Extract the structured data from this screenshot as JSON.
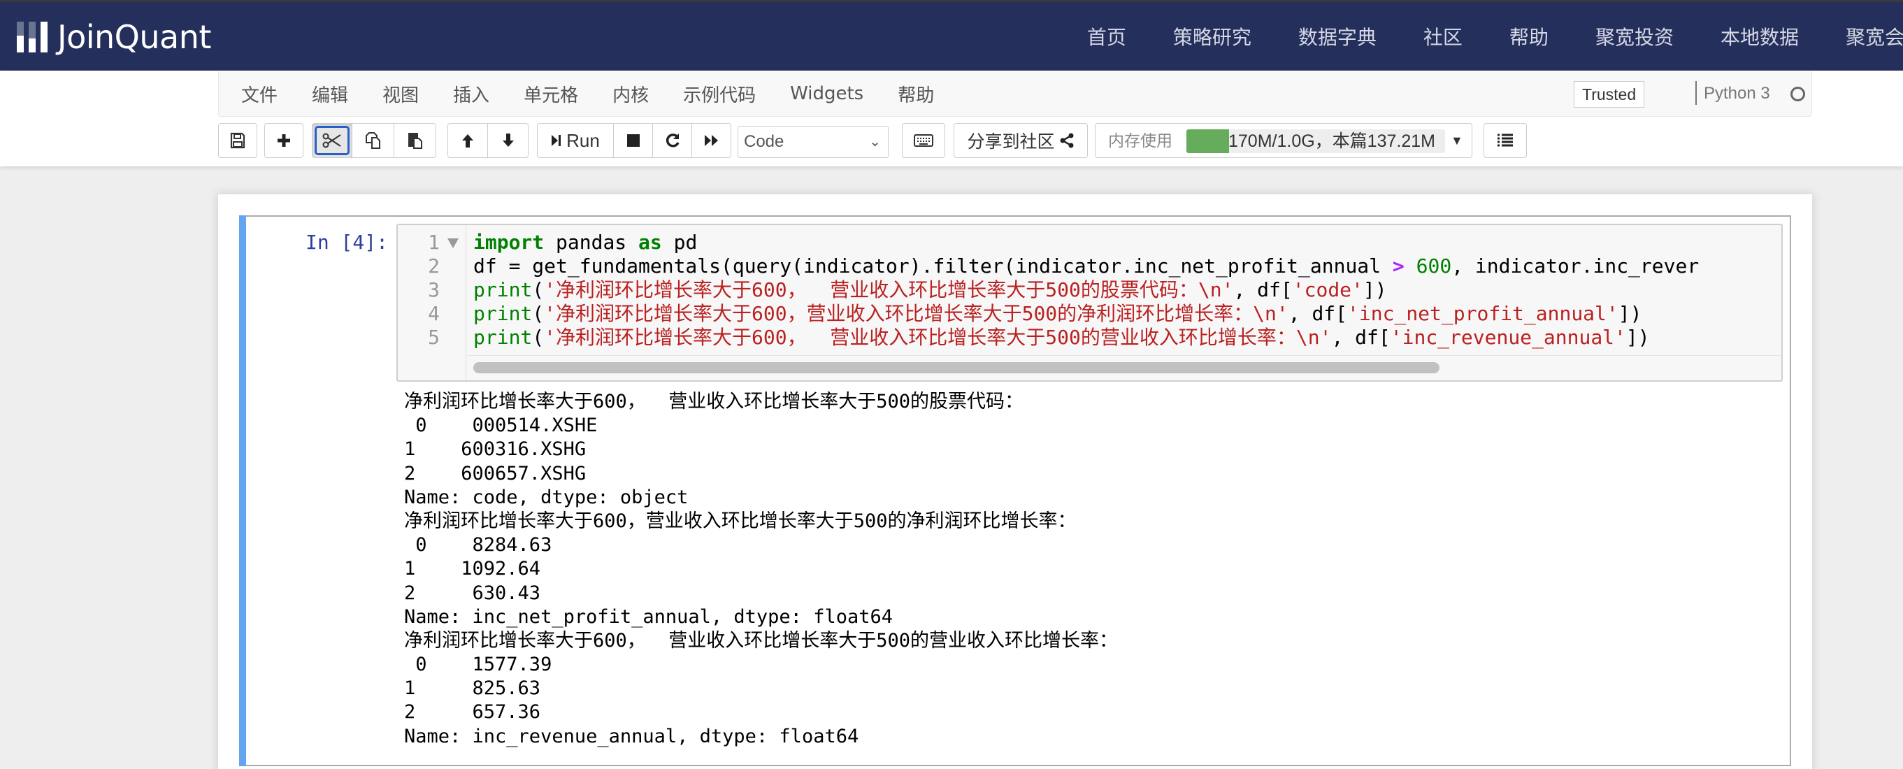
{
  "header": {
    "brand": "JoinQuant",
    "nav": [
      "首页",
      "策略研究",
      "数据字典",
      "社区",
      "帮助",
      "聚宽投资",
      "本地数据",
      "聚宽会员"
    ]
  },
  "menubar": {
    "items": [
      "文件",
      "编辑",
      "视图",
      "插入",
      "单元格",
      "内核",
      "示例代码",
      "Widgets",
      "帮助"
    ],
    "trusted": "Trusted",
    "kernel_name": "Python 3",
    "kernel_status_icon": "circle-idle-icon"
  },
  "toolbar": {
    "save_icon": "floppy-disk-icon",
    "insert_icon": "plus-icon",
    "cut_icon": "scissors-icon",
    "copy_icon": "copy-icon",
    "paste_icon": "paste-icon",
    "move_up_icon": "arrow-up-icon",
    "move_down_icon": "arrow-down-icon",
    "run_label": "Run",
    "run_icon": "step-forward-icon",
    "interrupt_icon": "stop-icon",
    "restart_icon": "redo-icon",
    "restart_run_all_icon": "fast-forward-icon",
    "cell_type": "Code",
    "keyboard_icon": "keyboard-icon",
    "share_label": "分享到社区",
    "share_icon": "share-icon",
    "memory_label": "内存使用",
    "memory_text": "170M/1.0G，本篇137.21M",
    "memory_fraction": 0.166,
    "memory_color": "#65ac5c",
    "toc_icon": "list-icon"
  },
  "cell": {
    "prompt": "In [4]:",
    "line_numbers": [
      "1",
      "2",
      "3",
      "4",
      "5"
    ],
    "code": [
      [
        {
          "t": "kw",
          "v": "import"
        },
        {
          "t": "",
          "v": " pandas "
        },
        {
          "t": "kw",
          "v": "as"
        },
        {
          "t": "",
          "v": " pd"
        }
      ],
      [
        {
          "t": "",
          "v": "df = get_fundamentals(query(indicator).filter(indicator.inc_net_profit_annual "
        },
        {
          "t": "op",
          "v": ">"
        },
        {
          "t": "",
          "v": " "
        },
        {
          "t": "num",
          "v": "600"
        },
        {
          "t": "",
          "v": ", indicator.inc_rever"
        }
      ],
      [
        {
          "t": "bi",
          "v": "print"
        },
        {
          "t": "",
          "v": "("
        },
        {
          "t": "str",
          "v": "'净利润环比增长率大于600，  营业收入环比增长率大于500的股票代码：\\n'"
        },
        {
          "t": "",
          "v": ", df["
        },
        {
          "t": "str",
          "v": "'code'"
        },
        {
          "t": "",
          "v": "])"
        }
      ],
      [
        {
          "t": "bi",
          "v": "print"
        },
        {
          "t": "",
          "v": "("
        },
        {
          "t": "str",
          "v": "'净利润环比增长率大于600，营业收入环比增长率大于500的净利润环比增长率：\\n'"
        },
        {
          "t": "",
          "v": ", df["
        },
        {
          "t": "str",
          "v": "'inc_net_profit_annual'"
        },
        {
          "t": "",
          "v": "])"
        }
      ],
      [
        {
          "t": "bi",
          "v": "print"
        },
        {
          "t": "",
          "v": "("
        },
        {
          "t": "str",
          "v": "'净利润环比增长率大于600，  营业收入环比增长率大于500的营业收入环比增长率：\\n'"
        },
        {
          "t": "",
          "v": ", df["
        },
        {
          "t": "str",
          "v": "'inc_revenue_annual'"
        },
        {
          "t": "",
          "v": "])"
        }
      ]
    ],
    "output": [
      "净利润环比增长率大于600，  营业收入环比增长率大于500的股票代码：",
      " 0    000514.XSHE",
      "1    600316.XSHG",
      "2    600657.XSHG",
      "Name: code, dtype: object",
      "净利润环比增长率大于600，营业收入环比增长率大于500的净利润环比增长率：",
      " 0    8284.63",
      "1    1092.64",
      "2     630.43",
      "Name: inc_net_profit_annual, dtype: float64",
      "净利润环比增长率大于600，  营业收入环比增长率大于500的营业收入环比增长率：",
      " 0    1577.39",
      "1     825.63",
      "2     657.36",
      "Name: inc_revenue_annual, dtype: float64"
    ]
  }
}
